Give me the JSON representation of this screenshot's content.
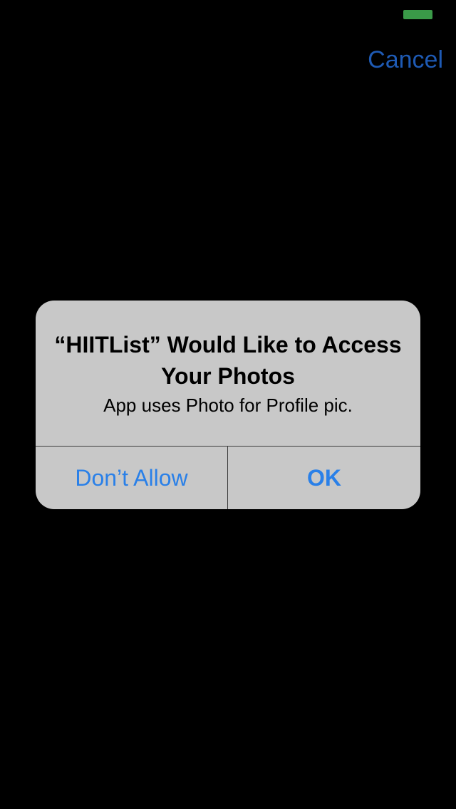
{
  "colors": {
    "background": "#000000",
    "battery": "#3a9a48",
    "cancel_text": "#1e5ab4",
    "alert_background": "#c8c8c8",
    "alert_text": "#000000",
    "button_text": "#2a80e8",
    "separator": "#3c3c3c"
  },
  "status_bar": {
    "battery_icon": "battery-icon"
  },
  "nav_bar": {
    "cancel_label": "Cancel"
  },
  "alert": {
    "title": "“HIITList” Would Like to Access Your Photos",
    "message": "App uses Photo for Profile pic.",
    "buttons": [
      {
        "label": "Don’t Allow",
        "style": "default"
      },
      {
        "label": "OK",
        "style": "preferred"
      }
    ]
  }
}
